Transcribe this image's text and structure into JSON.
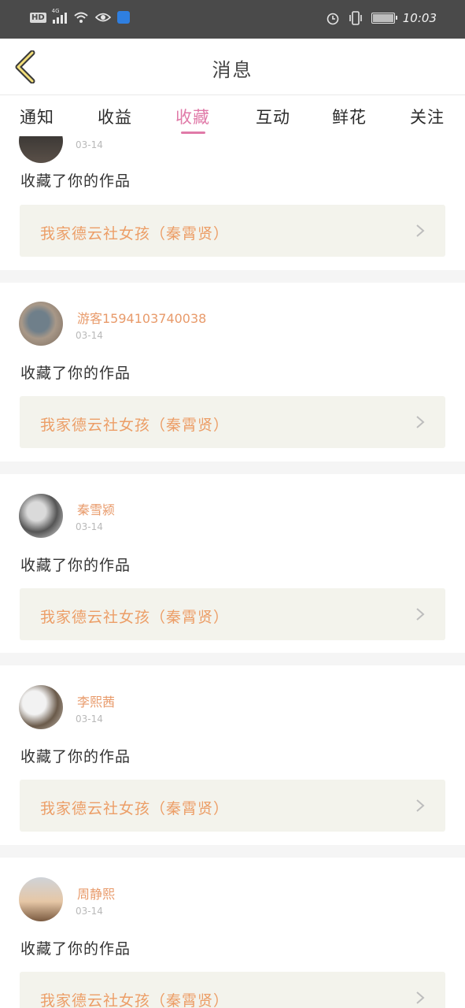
{
  "status_bar": {
    "hd": "HD",
    "network": "4G",
    "time": "10:03",
    "icons": [
      "signal-icon",
      "wifi-icon",
      "eye-icon",
      "baidu-app-icon",
      "alarm-icon",
      "vibrate-icon",
      "battery-icon"
    ]
  },
  "header": {
    "title": "消息",
    "back_icon": "chevron-left-icon"
  },
  "tabs": [
    {
      "label": "通知"
    },
    {
      "label": "收益"
    },
    {
      "label": "收藏"
    },
    {
      "label": "互动"
    },
    {
      "label": "鲜花"
    },
    {
      "label": "关注"
    }
  ],
  "active_tab": "收藏",
  "colors": {
    "accent_pink": "#e07aa8",
    "username_orange": "#e89a6a",
    "work_title_orange": "#ec9e67",
    "status_bar_bg": "#4a4a4a",
    "work_box_bg": "#f3f3ec"
  },
  "messages": [
    {
      "username": "",
      "date": "03-14",
      "action": "收藏了你的作品",
      "work_title": "我家德云社女孩（秦霄贤）"
    },
    {
      "username": "游客1594103740038",
      "date": "03-14",
      "action": "收藏了你的作品",
      "work_title": "我家德云社女孩（秦霄贤）"
    },
    {
      "username": "秦雪颍",
      "date": "03-14",
      "action": "收藏了你的作品",
      "work_title": "我家德云社女孩（秦霄贤）"
    },
    {
      "username": "李熙茜",
      "date": "03-14",
      "action": "收藏了你的作品",
      "work_title": "我家德云社女孩（秦霄贤）"
    },
    {
      "username": "周静熙",
      "date": "03-14",
      "action": "收藏了你的作品",
      "work_title": "我家德云社女孩（秦霄贤）"
    }
  ]
}
